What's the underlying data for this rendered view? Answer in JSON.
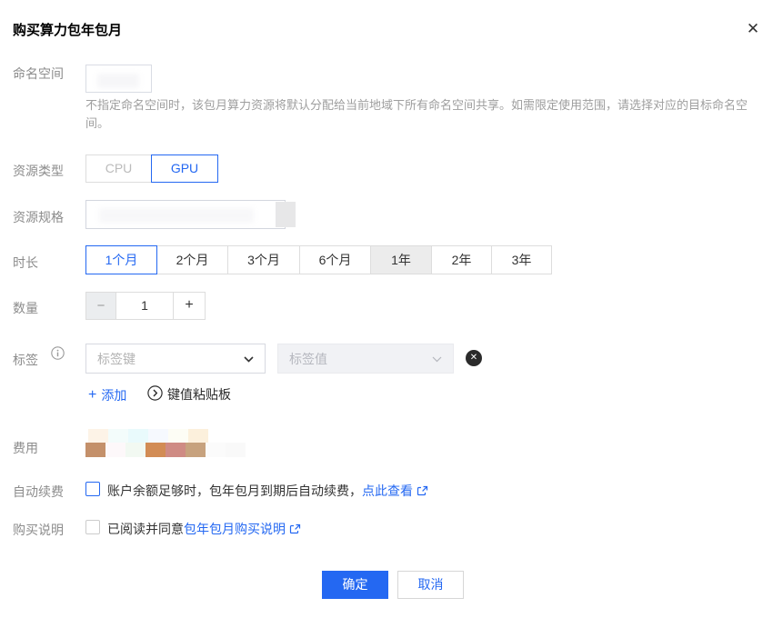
{
  "dialog": {
    "title": "购买算力包年包月",
    "close_icon": "✕"
  },
  "form": {
    "namespace": {
      "label": "命名空间",
      "help": "不指定命名空间时，该包月算力资源将默认分配给当前地域下所有命名空间共享。如需限定使用范围，请选择对应的目标命名空间。"
    },
    "resource_type": {
      "label": "资源类型",
      "options": [
        {
          "label": "CPU",
          "selected": false
        },
        {
          "label": "GPU",
          "selected": true
        }
      ]
    },
    "resource_spec": {
      "label": "资源规格"
    },
    "duration": {
      "label": "时长",
      "selected": "1个月",
      "options": [
        {
          "label": "1个月"
        },
        {
          "label": "2个月"
        },
        {
          "label": "3个月"
        },
        {
          "label": "6个月"
        },
        {
          "label": "1年"
        },
        {
          "label": "2年"
        },
        {
          "label": "3年"
        }
      ]
    },
    "quantity": {
      "label": "数量",
      "value": "1",
      "minus": "−",
      "plus": "+"
    },
    "tags": {
      "label": "标签",
      "key_placeholder": "标签键",
      "value_placeholder": "标签值",
      "delete_icon": "✕",
      "add_label": "添加",
      "add_plus": "+",
      "pasteboard_label": "键值粘贴板"
    },
    "cost": {
      "label": "费用",
      "mosaic_top": [
        "#fdf3e7",
        "#f3fcfb",
        "#e9fafc",
        "#f6f9fe",
        "#fdfdf5",
        "#fcf0dc"
      ],
      "mosaic_bottom": [
        "#c4906a",
        "#fdf8fa",
        "#f2f9f2",
        "#d28c55",
        "#cf8b84",
        "#c7a27e",
        "#fbfbfb",
        "#f9f9f9"
      ]
    },
    "auto_renew": {
      "label": "自动续费",
      "checked": false,
      "text": "账户余额足够时，包年包月到期后自动续费，",
      "link": "点此查看"
    },
    "purchase_note": {
      "label": "购买说明",
      "checked": false,
      "text": "已阅读并同意",
      "link": "包年包月购买说明"
    }
  },
  "footer": {
    "confirm_label": "确定",
    "cancel_label": "取消"
  },
  "colors": {
    "accent": "#2468f2",
    "link": "#2468f2"
  }
}
